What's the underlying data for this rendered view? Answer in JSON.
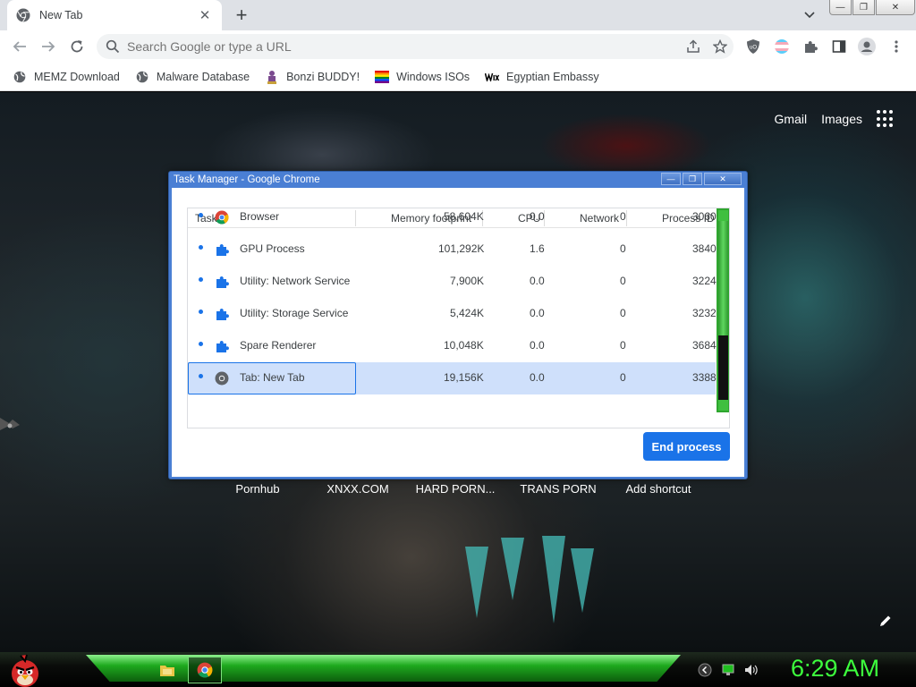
{
  "browser": {
    "tab": {
      "title": "New Tab",
      "close_glyph": "✕"
    },
    "new_tab_glyph": "+",
    "window_controls": {
      "minimize": "—",
      "maximize": "❐",
      "close": "✕"
    },
    "omnibox": {
      "placeholder": "Search Google or type a URL",
      "value": ""
    },
    "bookmarks": [
      {
        "label": "MEMZ Download",
        "icon": "globe-icon"
      },
      {
        "label": "Malware Database",
        "icon": "globe-icon"
      },
      {
        "label": "Bonzi BUDDY!",
        "icon": "bonzi-icon"
      },
      {
        "label": "Windows ISOs",
        "icon": "windows-flag-icon"
      },
      {
        "label": "Egyptian Embassy",
        "icon": "wix-icon"
      }
    ]
  },
  "new_tab_page": {
    "links": {
      "gmail": "Gmail",
      "images": "Images"
    },
    "shortcuts": [
      "Pornhub",
      "XNXX.COM",
      "HARD PORN...",
      "TRANS PORN",
      "Add shortcut"
    ]
  },
  "task_manager": {
    "title": "Task Manager - Google Chrome",
    "columns": [
      "Task",
      "Memory footprint",
      "CPU",
      "Network",
      "Process ID"
    ],
    "rows": [
      {
        "task": "Browser",
        "memory": "58,604K",
        "cpu": "0.0",
        "network": "0",
        "pid": "3060",
        "icon": "chrome-icon"
      },
      {
        "task": "GPU Process",
        "memory": "101,292K",
        "cpu": "1.6",
        "network": "0",
        "pid": "3840",
        "icon": "puzzle-icon"
      },
      {
        "task": "Utility: Network Service",
        "memory": "7,900K",
        "cpu": "0.0",
        "network": "0",
        "pid": "3224",
        "icon": "puzzle-icon"
      },
      {
        "task": "Utility: Storage Service",
        "memory": "5,424K",
        "cpu": "0.0",
        "network": "0",
        "pid": "3232",
        "icon": "puzzle-icon"
      },
      {
        "task": "Spare Renderer",
        "memory": "10,048K",
        "cpu": "0.0",
        "network": "0",
        "pid": "3684",
        "icon": "puzzle-icon"
      },
      {
        "task": "Tab: New Tab",
        "memory": "19,156K",
        "cpu": "0.0",
        "network": "0",
        "pid": "3388",
        "icon": "chrome-gray-icon",
        "selected": true
      }
    ],
    "end_process_label": "End process"
  },
  "taskbar": {
    "clock": "6:29 AM"
  },
  "colors": {
    "chrome_blue": "#1a73e8",
    "taskbar_green": "#1ea91e",
    "clock_green": "#3dff3d",
    "tm_titlebar": "#4a7fd4"
  }
}
